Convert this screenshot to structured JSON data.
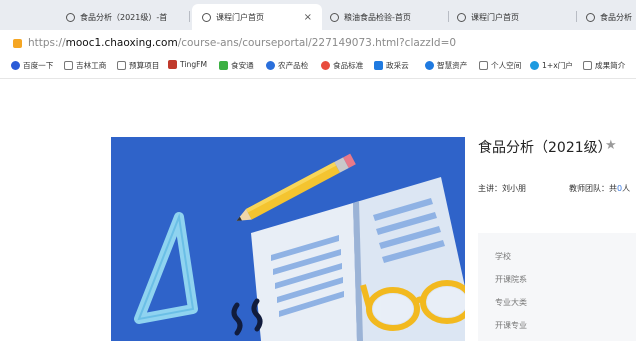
{
  "tabs": [
    {
      "label": "食品分析（2021级）-首",
      "active": false
    },
    {
      "label": "课程门户首页",
      "active": true,
      "close": "×"
    },
    {
      "label": "粮油食品检验-首页",
      "active": false
    },
    {
      "label": "课程门户首页",
      "active": false
    },
    {
      "label": "食品分析",
      "active": false
    }
  ],
  "address": {
    "scheme": "https://",
    "domain": "mooc1.chaoxing.com",
    "path": "/course-ans/courseportal/227149073.html?clazzId=0"
  },
  "bookmarks": [
    {
      "label": "百度一下",
      "icon": "paw-icon",
      "color": "#2a5bd7"
    },
    {
      "label": "吉林工商",
      "icon": "doc-icon",
      "color": "#777777"
    },
    {
      "label": "预算项目",
      "icon": "doc-icon",
      "color": "#777777"
    },
    {
      "label": "TingFM",
      "icon": "fm-icon",
      "color": "#c0392b"
    },
    {
      "label": "食安通",
      "icon": "app-icon",
      "color": "#3cb043"
    },
    {
      "label": "农产品检",
      "icon": "app-icon",
      "color": "#2a6fdb"
    },
    {
      "label": "食品标准",
      "icon": "app-icon",
      "color": "#e84c3d"
    },
    {
      "label": "政采云",
      "icon": "app-icon",
      "color": "#1f7ae0"
    },
    {
      "label": "智慧资产",
      "icon": "app-icon",
      "color": "#1f7ae0"
    },
    {
      "label": "个人空间",
      "icon": "doc-icon",
      "color": "#777777"
    },
    {
      "label": "1+x门户",
      "icon": "app-icon",
      "color": "#1f9be0"
    },
    {
      "label": "成果简介",
      "icon": "doc-icon",
      "color": "#777777"
    }
  ],
  "course": {
    "title": "食品分析（2021级）",
    "star": "★",
    "lecturer_label": "主讲：",
    "lecturer": "刘小朋",
    "team_label": "教师团队：共",
    "team_count": "0",
    "team_unit": "人",
    "info_labels": [
      "学校",
      "开课院系",
      "专业大类",
      "开课专业"
    ]
  },
  "colors": {
    "cover_bg": "#2f63c9",
    "accent_blue": "#3a7ae0"
  }
}
